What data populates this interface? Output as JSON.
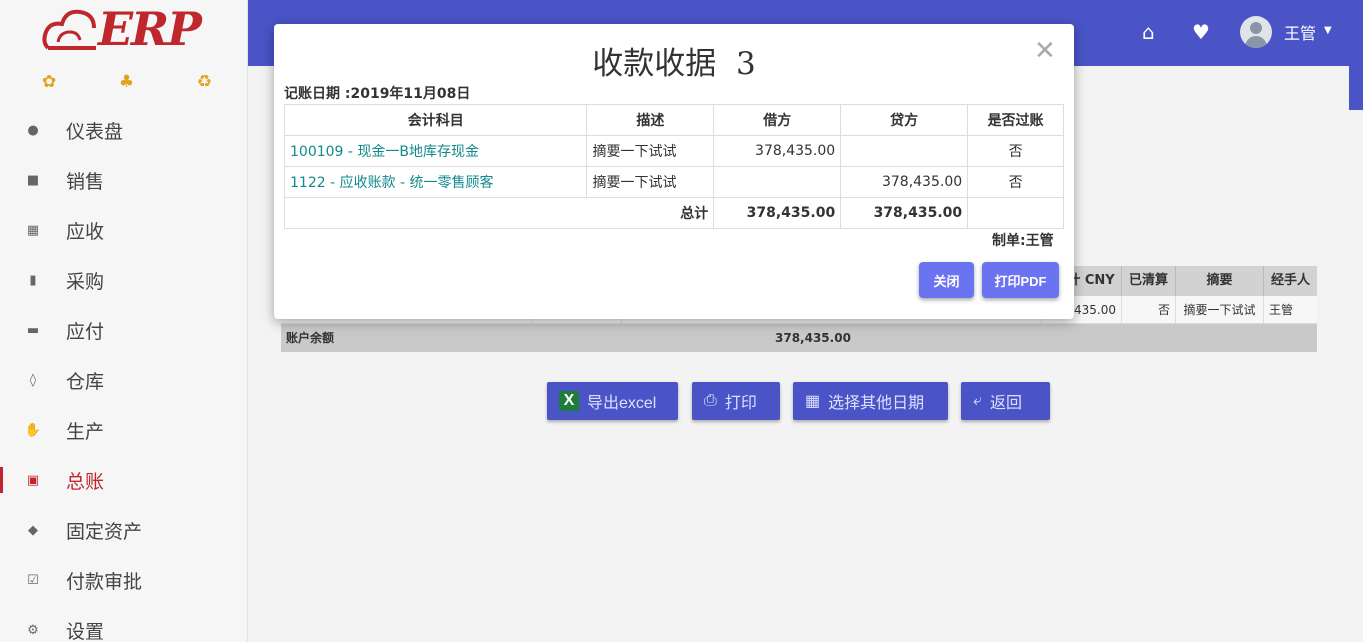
{
  "brand": {
    "logo_text": "ERP"
  },
  "sidebar": {
    "items": [
      {
        "label": "仪表盘",
        "icon": "dashboard-icon"
      },
      {
        "label": "销售",
        "icon": "cart-icon"
      },
      {
        "label": "应收",
        "icon": "grid-icon"
      },
      {
        "label": "采购",
        "icon": "truck-icon"
      },
      {
        "label": "应付",
        "icon": "card-icon"
      },
      {
        "label": "仓库",
        "icon": "boxes-icon"
      },
      {
        "label": "生产",
        "icon": "hand-icon"
      },
      {
        "label": "总账",
        "icon": "calculator-icon",
        "active": true
      },
      {
        "label": "固定资产",
        "icon": "tags-icon"
      },
      {
        "label": "付款审批",
        "icon": "checkbox-icon"
      },
      {
        "label": "设置",
        "icon": "cogs-icon"
      }
    ]
  },
  "topbar": {
    "user_name": "王管"
  },
  "ledger": {
    "headers": [
      "计 CNY",
      "已清算",
      "摘要",
      "经手人"
    ],
    "row": {
      "amount": "435.00",
      "cleared": "否",
      "summary": "摘要一下试试",
      "handler": "王管"
    },
    "total_label": "账户余额",
    "total_value": "378,435.00"
  },
  "actions": {
    "export_label": "导出excel",
    "print_label": "打印",
    "choose_date_label": "选择其他日期",
    "back_label": "返回"
  },
  "modal": {
    "title": "收款收据  3",
    "date_line": "记账日期 :2019年11月08日",
    "columns": [
      "会计科目",
      "描述",
      "借方",
      "贷方",
      "是否过账"
    ],
    "rows": [
      {
        "account": "100109 - 现金一B地库存现金",
        "desc": "摘要一下试试",
        "debit": "378,435.00",
        "credit": "",
        "posted": "否"
      },
      {
        "account": "1122 - 应收账款 - 统一零售顾客",
        "desc": "摘要一下试试",
        "debit": "",
        "credit": "378,435.00",
        "posted": "否"
      }
    ],
    "total_label": "总计",
    "total_debit": "378,435.00",
    "total_credit": "378,435.00",
    "maker": "制单:王管",
    "close_label": "关闭",
    "print_pdf_label": "打印PDF"
  }
}
